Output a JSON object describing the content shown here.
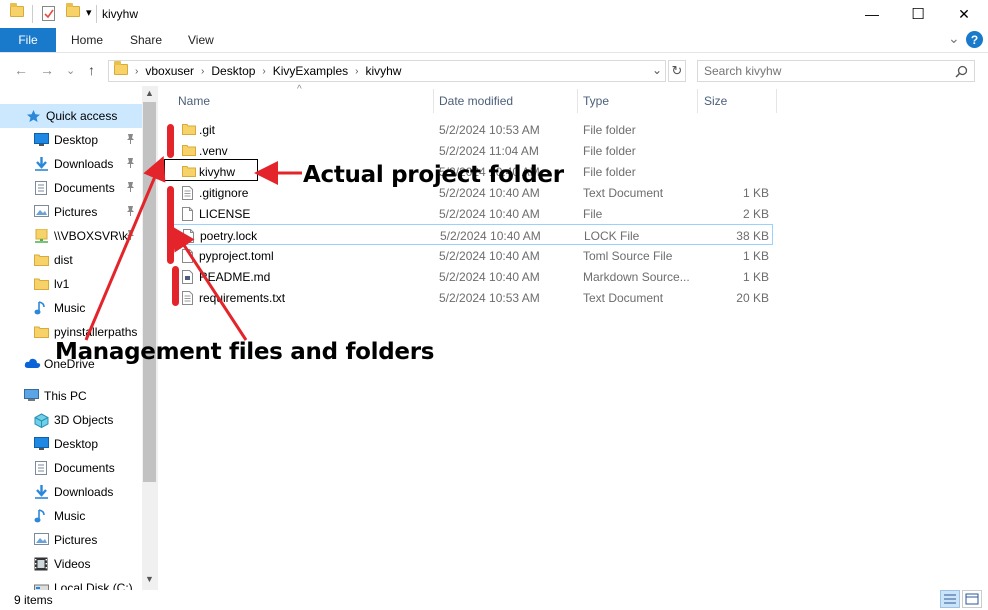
{
  "window": {
    "title": "kivyhw",
    "minimize_glyph": "—",
    "maximize_glyph": "☐",
    "close_glyph": "✕",
    "qa_dropdown_glyph": "▾"
  },
  "ribbon": {
    "tabs": [
      "File",
      "Home",
      "Share",
      "View"
    ],
    "collapse_glyph": "⌄",
    "help_glyph": "?"
  },
  "nav_buttons": {
    "back": "←",
    "forward": "→",
    "recent": "⌄",
    "up": "↑"
  },
  "address": {
    "crumbs": [
      "vboxuser",
      "Desktop",
      "KivyExamples",
      "kivyhw"
    ],
    "separator": "›",
    "dropdown_glyph": "⌄",
    "refresh_glyph": "↻"
  },
  "search": {
    "placeholder": "Search kivyhw",
    "icon": "search-icon"
  },
  "columns": {
    "name": "Name",
    "date": "Date modified",
    "type": "Type",
    "size": "Size"
  },
  "sort_glyph": "^",
  "files": [
    {
      "name": ".git",
      "date": "5/2/2024 10:53 AM",
      "type": "File folder",
      "size": "",
      "icon": "folder-icon"
    },
    {
      "name": ".venv",
      "date": "5/2/2024 11:04 AM",
      "type": "File folder",
      "size": "",
      "icon": "folder-icon"
    },
    {
      "name": "kivyhw",
      "date": "5/2/2024 10:40 AM",
      "type": "File folder",
      "size": "",
      "icon": "folder-icon"
    },
    {
      "name": ".gitignore",
      "date": "5/2/2024 10:40 AM",
      "type": "Text Document",
      "size": "1 KB",
      "icon": "text-document-icon"
    },
    {
      "name": "LICENSE",
      "date": "5/2/2024 10:40 AM",
      "type": "File",
      "size": "2 KB",
      "icon": "file-icon"
    },
    {
      "name": "poetry.lock",
      "date": "5/2/2024 10:40 AM",
      "type": "LOCK File",
      "size": "38 KB",
      "icon": "file-icon"
    },
    {
      "name": "pyproject.toml",
      "date": "5/2/2024 10:40 AM",
      "type": "Toml Source File",
      "size": "1 KB",
      "icon": "file-icon"
    },
    {
      "name": "README.md",
      "date": "5/2/2024 10:40 AM",
      "type": "Markdown Source...",
      "size": "1 KB",
      "icon": "markdown-file-icon"
    },
    {
      "name": "requirements.txt",
      "date": "5/2/2024 10:53 AM",
      "type": "Text Document",
      "size": "20 KB",
      "icon": "text-document-icon"
    }
  ],
  "sidebar": {
    "items": [
      {
        "label": "Quick access",
        "icon": "star-icon",
        "pinned": false
      },
      {
        "label": "Desktop",
        "icon": "desktop-icon",
        "pinned": true
      },
      {
        "label": "Downloads",
        "icon": "download-icon",
        "pinned": true
      },
      {
        "label": "Documents",
        "icon": "documents-icon",
        "pinned": true
      },
      {
        "label": "Pictures",
        "icon": "pictures-icon",
        "pinned": true
      },
      {
        "label": "\\\\VBOXSVR\\k",
        "icon": "network-share-icon",
        "pinned": true
      },
      {
        "label": "dist",
        "icon": "folder-icon",
        "pinned": false
      },
      {
        "label": "lv1",
        "icon": "folder-icon",
        "pinned": false
      },
      {
        "label": "Music",
        "icon": "music-icon",
        "pinned": false
      },
      {
        "label": "pyinstallerpaths",
        "icon": "folder-icon",
        "pinned": false
      },
      {
        "label": "OneDrive",
        "icon": "cloud-icon",
        "pinned": false
      },
      {
        "label": "This PC",
        "icon": "computer-icon",
        "pinned": false
      },
      {
        "label": "3D Objects",
        "icon": "cube-icon",
        "pinned": false
      },
      {
        "label": "Desktop",
        "icon": "desktop-icon",
        "pinned": false
      },
      {
        "label": "Documents",
        "icon": "documents-icon",
        "pinned": false
      },
      {
        "label": "Downloads",
        "icon": "download-icon",
        "pinned": false
      },
      {
        "label": "Music",
        "icon": "music-icon",
        "pinned": false
      },
      {
        "label": "Pictures",
        "icon": "pictures-icon",
        "pinned": false
      },
      {
        "label": "Videos",
        "icon": "videos-icon",
        "pinned": false
      },
      {
        "label": "Local Disk (C:)",
        "icon": "disk-icon",
        "pinned": false
      }
    ],
    "pin_glyph": "📌"
  },
  "status": {
    "items": "9 items"
  },
  "annotations": {
    "project_folder": "Actual project folder",
    "management": "Management files and folders",
    "color": "#e3252b"
  },
  "colors": {
    "accent": "#1979ca",
    "header_text": "#4c607a",
    "selection_border": "#99d1ff"
  }
}
